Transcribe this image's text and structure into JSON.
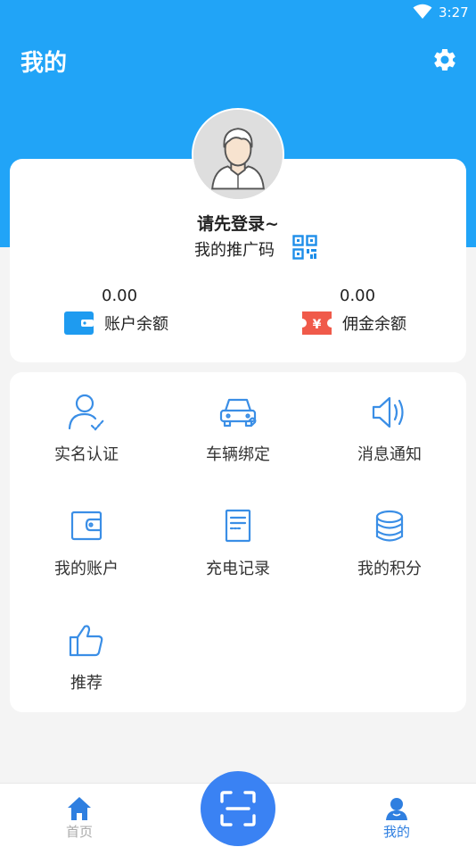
{
  "status_bar": {
    "time": "3:27"
  },
  "header": {
    "title": "我的"
  },
  "profile": {
    "login_prompt": "请先登录~",
    "promo_code_label": "我的推广码"
  },
  "balances": [
    {
      "value": "0.00",
      "label": "账户余额",
      "icon": "wallet-icon",
      "color": "#1e9bf0"
    },
    {
      "value": "0.00",
      "label": "佣金余额",
      "icon": "yen-ticket-icon",
      "color": "#f05a4a"
    }
  ],
  "menu": [
    {
      "label": "实名认证",
      "icon": "user-verify-icon"
    },
    {
      "label": "车辆绑定",
      "icon": "car-link-icon"
    },
    {
      "label": "消息通知",
      "icon": "speaker-icon"
    },
    {
      "label": "我的账户",
      "icon": "wallet-icon"
    },
    {
      "label": "充电记录",
      "icon": "document-icon"
    },
    {
      "label": "我的积分",
      "icon": "coins-icon"
    },
    {
      "label": "推荐",
      "icon": "thumbs-up-icon"
    }
  ],
  "bottom_nav": {
    "home_label": "首页",
    "mine_label": "我的",
    "active_color": "#2f7fe0",
    "inactive_color": "#aaaaaa"
  },
  "colors": {
    "brand_blue": "#21a4f7",
    "icon_blue": "#3a8ee6"
  }
}
